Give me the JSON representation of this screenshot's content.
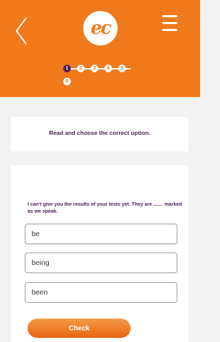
{
  "header": {
    "logo_text": "ec",
    "brand_color": "#f07a1c",
    "back_icon": "chevron-left-icon",
    "menu_icon": "hamburger-menu-icon",
    "steps": [
      "1",
      "2",
      "3",
      "4",
      "5",
      "6"
    ],
    "current_step": 1
  },
  "instruction": "Read and choose the correct option.",
  "question": "I can't give you the results of your tests yet. They are ....... marked as we speak.",
  "options": [
    "be",
    "being",
    "been"
  ],
  "check_label": "Check",
  "accent_color": "#4a1e57"
}
